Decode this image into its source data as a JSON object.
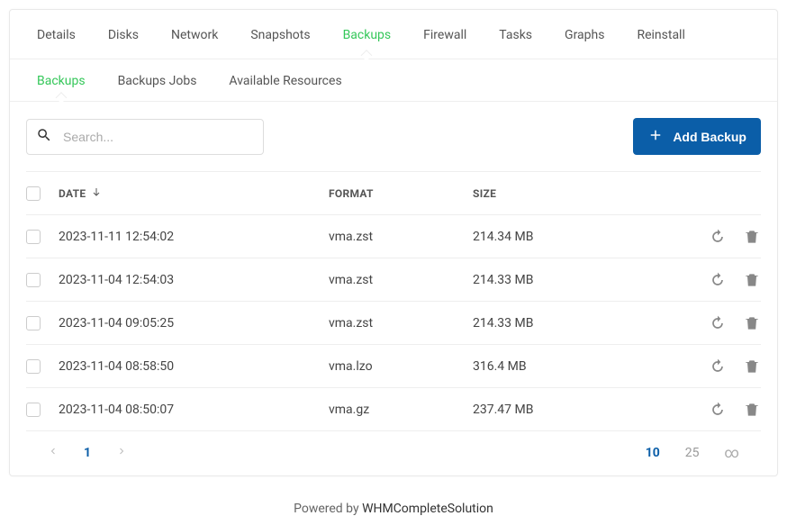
{
  "tabs_top": [
    {
      "label": "Details",
      "active": false
    },
    {
      "label": "Disks",
      "active": false
    },
    {
      "label": "Network",
      "active": false
    },
    {
      "label": "Snapshots",
      "active": false
    },
    {
      "label": "Backups",
      "active": true
    },
    {
      "label": "Firewall",
      "active": false
    },
    {
      "label": "Tasks",
      "active": false
    },
    {
      "label": "Graphs",
      "active": false
    },
    {
      "label": "Reinstall",
      "active": false
    }
  ],
  "tabs_sub": [
    {
      "label": "Backups",
      "active": true
    },
    {
      "label": "Backups Jobs",
      "active": false
    },
    {
      "label": "Available Resources",
      "active": false
    }
  ],
  "toolbar": {
    "search_placeholder": "Search...",
    "add_label": "Add Backup"
  },
  "columns": {
    "date": "Date",
    "format": "Format",
    "size": "Size"
  },
  "sort": {
    "column": "date",
    "dir": "desc"
  },
  "rows": [
    {
      "date": "2023-11-11 12:54:02",
      "format": "vma.zst",
      "size": "214.34 MB"
    },
    {
      "date": "2023-11-04 12:54:03",
      "format": "vma.zst",
      "size": "214.33 MB"
    },
    {
      "date": "2023-11-04 09:05:25",
      "format": "vma.zst",
      "size": "214.33 MB"
    },
    {
      "date": "2023-11-04 08:58:50",
      "format": "vma.lzo",
      "size": "316.4 MB"
    },
    {
      "date": "2023-11-04 08:50:07",
      "format": "vma.gz",
      "size": "237.47 MB"
    }
  ],
  "pager": {
    "current_page": "1",
    "page_sizes": [
      {
        "label": "10",
        "active": true
      },
      {
        "label": "25",
        "active": false
      },
      {
        "label": "∞",
        "active": false
      }
    ]
  },
  "footer": {
    "prefix": "Powered by ",
    "link": "WHMCompleteSolution"
  }
}
